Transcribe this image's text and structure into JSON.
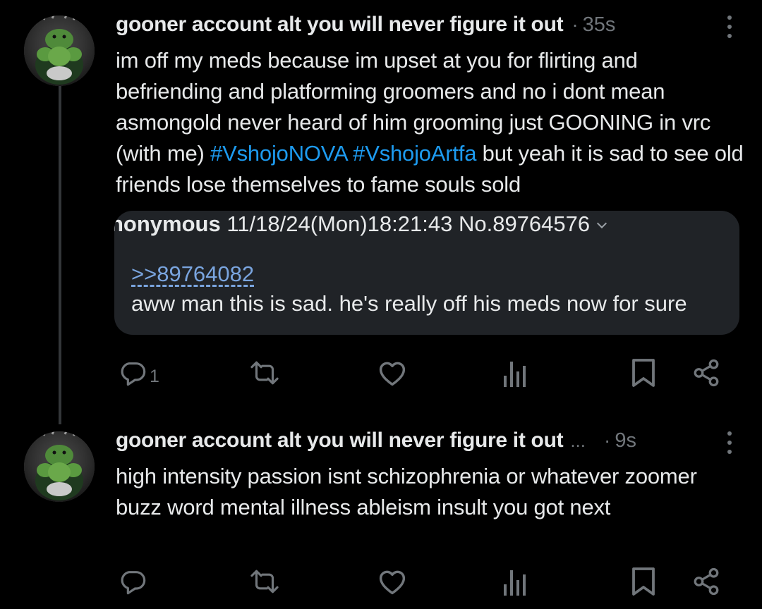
{
  "colors": {
    "background": "#000000",
    "text": "#e7e9ea",
    "muted": "#71767b",
    "hashtag": "#1d9bf0",
    "quote_bg": "#202327",
    "quote_link": "#7aa5df"
  },
  "post1": {
    "author": "gooner account alt you will never figure it out",
    "separator": "·",
    "time": "35s",
    "text_before": "im off my meds because im upset at you for flirting and befriending and platforming groomers and no i dont mean asmongold never heard of him grooming just GOONING in vrc (with me) ",
    "hashtag1": "#VshojoNOVA",
    "hashtag2": "#VshojoArtfa",
    "text_after": " but yeah it is sad to see old friends lose themselves to fame souls sold",
    "quote": {
      "name": "nonymous",
      "meta": "11/18/24(Mon)18:21:43 No.89764576",
      "reply_link": ">>89764082",
      "body": "aww man this is sad. he's really off his meds now for sure"
    },
    "actions": {
      "reply_icon": "reply-icon",
      "reply_count": "1",
      "repost_icon": "repost-icon",
      "like_icon": "heart-icon",
      "views_icon": "views-icon",
      "bookmark_icon": "bookmark-icon",
      "share_icon": "share-icon"
    }
  },
  "post2": {
    "author": "gooner account alt you will never figure it out",
    "ellipsis": "...",
    "separator": "·",
    "time": "9s",
    "text": "high intensity passion isnt schizophrenia or whatever zoomer buzz word mental illness ableism insult you got next"
  }
}
